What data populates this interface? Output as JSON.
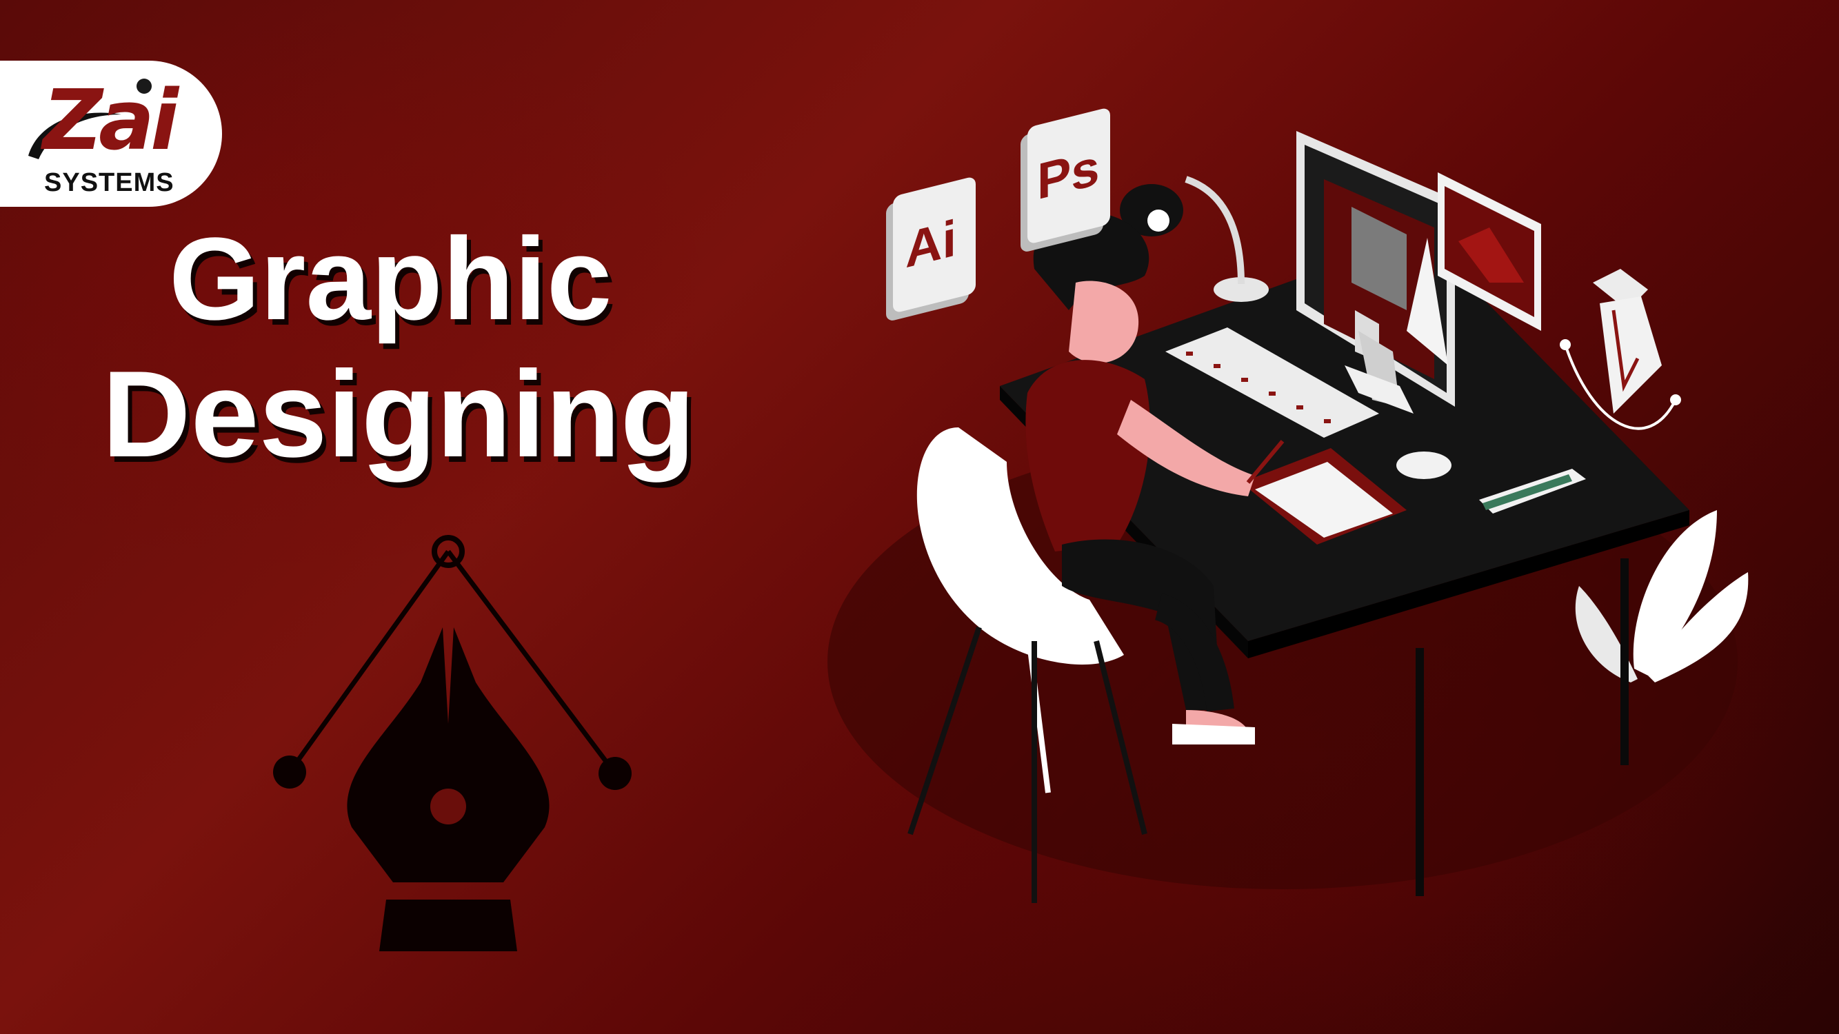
{
  "brand": {
    "logo_word": "Zai",
    "logo_sub": "SYSTEMS"
  },
  "headline": {
    "line1": "Graphic",
    "line2": "Designing"
  },
  "badges": {
    "illustrator": "Ai",
    "photoshop": "Ps"
  },
  "icons": [
    "pen-tool-icon",
    "desk-lamp-icon",
    "monitor-icon",
    "keyboard-icon",
    "mouse-icon",
    "drawing-tablet-icon",
    "color-swatch-icon",
    "plant-icon",
    "chair-icon",
    "image-icon"
  ],
  "colors": {
    "brand_red": "#8a1412",
    "background": "#6a0e0b",
    "text_light": "#ffffff",
    "ink": "#111111"
  }
}
